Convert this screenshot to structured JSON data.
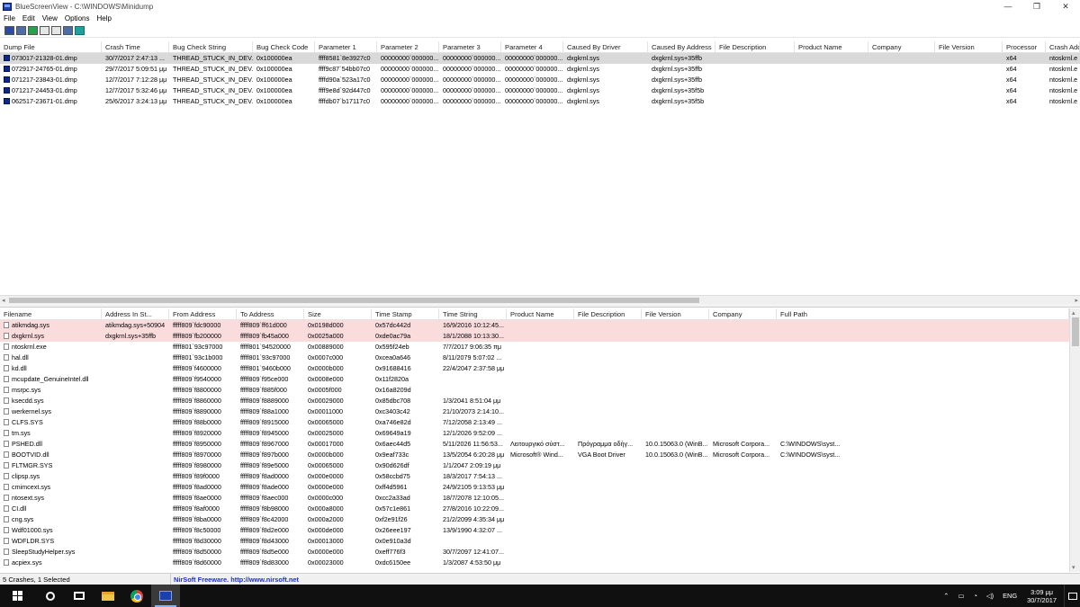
{
  "window": {
    "title": "BlueScreenView  -  C:\\WINDOWS\\Minidump",
    "minimize": "—",
    "maximize": "❐",
    "close": "✕"
  },
  "menu": [
    "File",
    "Edit",
    "View",
    "Options",
    "Help"
  ],
  "toolbar": [
    "save-icon",
    "html-report-icon",
    "refresh-icon",
    "copy-icon",
    "properties-icon",
    "find-icon",
    "exit-icon"
  ],
  "crash_columns": [
    {
      "label": "Dump File",
      "w": 113
    },
    {
      "label": "Crash Time",
      "w": 75
    },
    {
      "label": "Bug Check String",
      "w": 93
    },
    {
      "label": "Bug Check Code",
      "w": 69
    },
    {
      "label": "Parameter 1",
      "w": 69
    },
    {
      "label": "Parameter 2",
      "w": 69
    },
    {
      "label": "Parameter 3",
      "w": 69
    },
    {
      "label": "Parameter 4",
      "w": 69
    },
    {
      "label": "Caused By Driver",
      "w": 94
    },
    {
      "label": "Caused By Address",
      "w": 75
    },
    {
      "label": "File Description",
      "w": 88
    },
    {
      "label": "Product Name",
      "w": 82
    },
    {
      "label": "Company",
      "w": 74
    },
    {
      "label": "File Version",
      "w": 75
    },
    {
      "label": "Processor",
      "w": 48
    },
    {
      "label": "Crash Add",
      "w": 38
    }
  ],
  "crashes": [
    {
      "selected": true,
      "cells": [
        "073017-21328-01.dmp",
        "30/7/2017 2:47:13 ...",
        "THREAD_STUCK_IN_DEV...",
        "0x100000ea",
        "ffff8581`8e3927c0",
        "00000000`000000...",
        "00000000`000000...",
        "00000000`000000...",
        "dxgkrnl.sys",
        "dxgkrnl.sys+35ffb",
        "",
        "",
        "",
        "",
        "x64",
        "ntoskrnl.e"
      ]
    },
    {
      "selected": false,
      "cells": [
        "072917-24765-01.dmp",
        "29/7/2017 5:09:51 μμ",
        "THREAD_STUCK_IN_DEV...",
        "0x100000ea",
        "ffff9c87`54bb07c0",
        "00000000`000000...",
        "00000000`000000...",
        "00000000`000000...",
        "dxgkrnl.sys",
        "dxgkrnl.sys+35ffb",
        "",
        "",
        "",
        "",
        "x64",
        "ntoskrnl.e"
      ]
    },
    {
      "selected": false,
      "cells": [
        "071217-23843-01.dmp",
        "12/7/2017 7:12:28 μμ",
        "THREAD_STUCK_IN_DEV...",
        "0x100000ea",
        "ffffd90a`523a17c0",
        "00000000`000000...",
        "00000000`000000...",
        "00000000`000000...",
        "dxgkrnl.sys",
        "dxgkrnl.sys+35ffb",
        "",
        "",
        "",
        "",
        "x64",
        "ntoskrnl.e"
      ]
    },
    {
      "selected": false,
      "cells": [
        "071217-24453-01.dmp",
        "12/7/2017 5:32:46 μμ",
        "THREAD_STUCK_IN_DEV...",
        "0x100000ea",
        "ffff9e8d`92d447c0",
        "00000000`000000...",
        "00000000`000000...",
        "00000000`000000...",
        "dxgkrnl.sys",
        "dxgkrnl.sys+35f5b",
        "",
        "",
        "",
        "",
        "x64",
        "ntoskrnl.e"
      ]
    },
    {
      "selected": false,
      "cells": [
        "062517-23671-01.dmp",
        "25/6/2017 3:24:13 μμ",
        "THREAD_STUCK_IN_DEV...",
        "0x100000ea",
        "ffffdb07`b17117c0",
        "00000000`000000...",
        "00000000`000000...",
        "00000000`000000...",
        "dxgkrnl.sys",
        "dxgkrnl.sys+35f5b",
        "",
        "",
        "",
        "",
        "x64",
        "ntoskrnl.e"
      ]
    }
  ],
  "driver_columns": [
    {
      "label": "Filename",
      "w": 113
    },
    {
      "label": "Address In St...",
      "w": 75
    },
    {
      "label": "From Address",
      "w": 75
    },
    {
      "label": "To Address",
      "w": 75
    },
    {
      "label": "Size",
      "w": 75
    },
    {
      "label": "Time Stamp",
      "w": 75
    },
    {
      "label": "Time String",
      "w": 75
    },
    {
      "label": "Product Name",
      "w": 75
    },
    {
      "label": "File Description",
      "w": 75
    },
    {
      "label": "File Version",
      "w": 75
    },
    {
      "label": "Company",
      "w": 75
    },
    {
      "label": "Full Path",
      "w": 325
    }
  ],
  "drivers": [
    {
      "hl": true,
      "cells": [
        "atikmdag.sys",
        "atikmdag.sys+50904",
        "fffff809`fdc90000",
        "fffff809`ff61d000",
        "0x0198d000",
        "0x57dc442d",
        "16/9/2016 10:12:45...",
        "",
        "",
        "",
        "",
        ""
      ]
    },
    {
      "hl": true,
      "cells": [
        "dxgkrnl.sys",
        "dxgkrnl.sys+35ffb",
        "fffff809`fb200000",
        "fffff809`fb45a000",
        "0x0025a000",
        "0xde0ac79a",
        "18/1/2088 10:13:30...",
        "",
        "",
        "",
        "",
        ""
      ]
    },
    {
      "hl": false,
      "cells": [
        "ntoskrnl.exe",
        "",
        "fffff801`93c97000",
        "fffff801`94520000",
        "0x00889000",
        "0x595f24eb",
        "7/7/2017 9:06:35 πμ",
        "",
        "",
        "",
        "",
        ""
      ]
    },
    {
      "hl": false,
      "cells": [
        "hal.dll",
        "",
        "fffff801`93c1b000",
        "fffff801`93c97000",
        "0x0007c000",
        "0xcea0a646",
        "8/11/2079 5:07:02 ...",
        "",
        "",
        "",
        "",
        ""
      ]
    },
    {
      "hl": false,
      "cells": [
        "kd.dll",
        "",
        "fffff809`f4600000",
        "fffff801`9460b000",
        "0x0000b000",
        "0x91688416",
        "22/4/2047 2:37:58 μμ",
        "",
        "",
        "",
        "",
        ""
      ]
    },
    {
      "hl": false,
      "cells": [
        "mcupdate_GenuineIntel.dll",
        "",
        "fffff809`f9540000",
        "fffff809`f95ce000",
        "0x0008e000",
        "0x11f2820a",
        "",
        "",
        "",
        "",
        "",
        ""
      ]
    },
    {
      "hl": false,
      "cells": [
        "msrpc.sys",
        "",
        "fffff809`f8800000",
        "fffff809`f885f000",
        "0x0005f000",
        "0x16a8209d",
        "",
        "",
        "",
        "",
        "",
        ""
      ]
    },
    {
      "hl": false,
      "cells": [
        "ksecdd.sys",
        "",
        "fffff809`f8860000",
        "fffff809`f8889000",
        "0x00029000",
        "0x85dbc708",
        "1/3/2041 8:51:04 μμ",
        "",
        "",
        "",
        "",
        ""
      ]
    },
    {
      "hl": false,
      "cells": [
        "werkernel.sys",
        "",
        "fffff809`f8890000",
        "fffff809`f88a1000",
        "0x00011000",
        "0xc3403c42",
        "21/10/2073 2:14:10...",
        "",
        "",
        "",
        "",
        ""
      ]
    },
    {
      "hl": false,
      "cells": [
        "CLFS.SYS",
        "",
        "fffff809`f88b0000",
        "fffff809`f8915000",
        "0x00065000",
        "0xa746e82d",
        "7/12/2058 2:13:49 ...",
        "",
        "",
        "",
        "",
        ""
      ]
    },
    {
      "hl": false,
      "cells": [
        "tm.sys",
        "",
        "fffff809`f8920000",
        "fffff809`f8945000",
        "0x00025000",
        "0x69649a19",
        "12/1/2026 9:52:09 ...",
        "",
        "",
        "",
        "",
        ""
      ]
    },
    {
      "hl": false,
      "cells": [
        "PSHED.dll",
        "",
        "fffff809`f8950000",
        "fffff809`f8967000",
        "0x00017000",
        "0x6aec44d5",
        "5/11/2026 11:56:53...",
        "Λειτουργικό σύστ...",
        "Πρόγραμμα οδήγ...",
        "10.0.15063.0 (WinB...",
        "Microsoft Corpora...",
        "C:\\WINDOWS\\syst..."
      ]
    },
    {
      "hl": false,
      "cells": [
        "BOOTVID.dll",
        "",
        "fffff809`f8970000",
        "fffff809`f897b000",
        "0x0000b000",
        "0x9eaf733c",
        "13/5/2054 6:20:28 μμ",
        "Microsoft® Wind...",
        "VGA Boot Driver",
        "10.0.15063.0 (WinB...",
        "Microsoft Corpora...",
        "C:\\WINDOWS\\syst..."
      ]
    },
    {
      "hl": false,
      "cells": [
        "FLTMGR.SYS",
        "",
        "fffff809`f8980000",
        "fffff809`f89e5000",
        "0x00065000",
        "0x90d626df",
        "1/1/2047 2:09:19 μμ",
        "",
        "",
        "",
        "",
        ""
      ]
    },
    {
      "hl": false,
      "cells": [
        "clipsp.sys",
        "",
        "fffff809`f89f0000",
        "fffff809`f8ad0000",
        "0x000e0000",
        "0x58ccbd75",
        "18/3/2017 7:54:13 ...",
        "",
        "",
        "",
        "",
        ""
      ]
    },
    {
      "hl": false,
      "cells": [
        "cmimcext.sys",
        "",
        "fffff809`f8ad0000",
        "fffff809`f8ade000",
        "0x0000e000",
        "0xff4d5961",
        "24/9/2105 9:13:53 μμ",
        "",
        "",
        "",
        "",
        ""
      ]
    },
    {
      "hl": false,
      "cells": [
        "ntosext.sys",
        "",
        "fffff809`f8ae0000",
        "fffff809`f8aec000",
        "0x0000c000",
        "0xcc2a33ad",
        "18/7/2078 12:10:05...",
        "",
        "",
        "",
        "",
        ""
      ]
    },
    {
      "hl": false,
      "cells": [
        "CI.dll",
        "",
        "fffff809`f8af0000",
        "fffff809`f8b98000",
        "0x000a8000",
        "0x57c1e861",
        "27/8/2016 10:22:09...",
        "",
        "",
        "",
        "",
        ""
      ]
    },
    {
      "hl": false,
      "cells": [
        "cng.sys",
        "",
        "fffff809`f8ba0000",
        "fffff809`f8c42000",
        "0x000a2000",
        "0xf2e91f26",
        "21/2/2099 4:35:34 μμ",
        "",
        "",
        "",
        "",
        ""
      ]
    },
    {
      "hl": false,
      "cells": [
        "Wdf01000.sys",
        "",
        "fffff809`f8c50000",
        "fffff809`f8d2e000",
        "0x000de000",
        "0x26eee197",
        "13/9/1990 4:32:07 ...",
        "",
        "",
        "",
        "",
        ""
      ]
    },
    {
      "hl": false,
      "cells": [
        "WDFLDR.SYS",
        "",
        "fffff809`f8d30000",
        "fffff809`f8d43000",
        "0x00013000",
        "0x0e910a3d",
        "",
        "",
        "",
        "",
        "",
        ""
      ]
    },
    {
      "hl": false,
      "cells": [
        "SleepStudyHelper.sys",
        "",
        "fffff809`f8d50000",
        "fffff809`f8d5e000",
        "0x0000e000",
        "0xeff776f3",
        "30/7/2097 12:41:07...",
        "",
        "",
        "",
        "",
        ""
      ]
    },
    {
      "hl": false,
      "cells": [
        "acpiex.sys",
        "",
        "fffff809`f8d60000",
        "fffff809`f8d83000",
        "0x00023000",
        "0xdc6150ee",
        "1/3/2087 4:53:50 μμ",
        "",
        "",
        "",
        "",
        ""
      ]
    }
  ],
  "status": {
    "count": "5 Crashes, 1 Selected",
    "credit": "NirSoft Freeware.  http://www.nirsoft.net"
  },
  "taskbar": {
    "lang": "ENG",
    "time": "3:09 μμ",
    "date": "30/7/2017",
    "icons": [
      "start-icon",
      "search-icon",
      "task-view-icon",
      "file-explorer-icon",
      "chrome-icon",
      "bluescreenview-icon"
    ]
  }
}
